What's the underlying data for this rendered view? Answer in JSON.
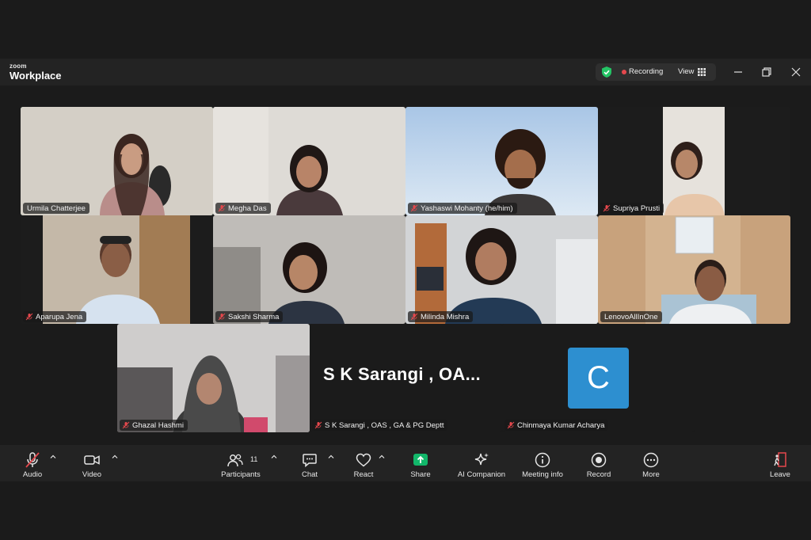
{
  "app": {
    "logo_small": "zoom",
    "logo_big": "Workplace",
    "recording_label": "Recording",
    "view_label": "View"
  },
  "participants": [
    {
      "name": "Urmila Chatterjee",
      "muted": false,
      "active": true
    },
    {
      "name": "Megha Das",
      "muted": true
    },
    {
      "name": "Yashaswi Mohanty (he/him)",
      "muted": true
    },
    {
      "name": "Supriya Prusti",
      "muted": true
    },
    {
      "name": "Aparupa Jena",
      "muted": true
    },
    {
      "name": "Sakshi Sharma",
      "muted": true
    },
    {
      "name": "Milinda Mishra",
      "muted": true
    },
    {
      "name": "LenovoAllInOne",
      "muted": false
    },
    {
      "name": "Ghazal Hashmi",
      "muted": true
    },
    {
      "name": "S K Sarangi , OAS , GA & PG Deptt",
      "muted": true,
      "video_off_display": "S K Sarangi , OA..."
    },
    {
      "name": "Chinmaya Kumar Acharya",
      "muted": true,
      "avatar_letter": "C"
    }
  ],
  "toolbar": {
    "audio": "Audio",
    "video": "Video",
    "participants": "Participants",
    "participants_count": "11",
    "chat": "Chat",
    "react": "React",
    "share": "Share",
    "ai_companion": "AI Companion",
    "meeting_info": "Meeting info",
    "record": "Record",
    "more": "More",
    "leave": "Leave"
  },
  "colors": {
    "active_speaker_border": "#3cc68a",
    "recording_dot": "#e5484d",
    "share_green": "#12b76a",
    "leave_red": "#e5484d",
    "avatar_blue": "#2d8fd0"
  }
}
